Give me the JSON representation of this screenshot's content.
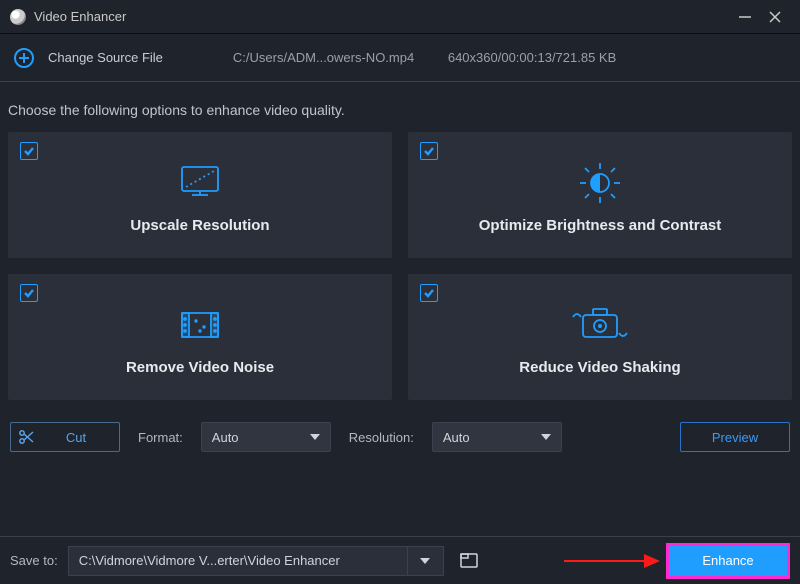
{
  "app": {
    "title": "Video Enhancer"
  },
  "source": {
    "change_label": "Change Source File",
    "path": "C:/Users/ADM...owers-NO.mp4",
    "meta": "640x360/00:00:13/721.85 KB"
  },
  "instructions": "Choose the following options to enhance video quality.",
  "cards": {
    "upscale": {
      "label": "Upscale Resolution",
      "checked": true
    },
    "brightness": {
      "label": "Optimize Brightness and Contrast",
      "checked": true
    },
    "noise": {
      "label": "Remove Video Noise",
      "checked": true
    },
    "shaking": {
      "label": "Reduce Video Shaking",
      "checked": true
    }
  },
  "controls": {
    "cut_label": "Cut",
    "format_label": "Format:",
    "format_value": "Auto",
    "resolution_label": "Resolution:",
    "resolution_value": "Auto",
    "preview_label": "Preview"
  },
  "bottom": {
    "save_to_label": "Save to:",
    "save_path": "C:\\Vidmore\\Vidmore V...erter\\Video Enhancer",
    "enhance_label": "Enhance"
  }
}
